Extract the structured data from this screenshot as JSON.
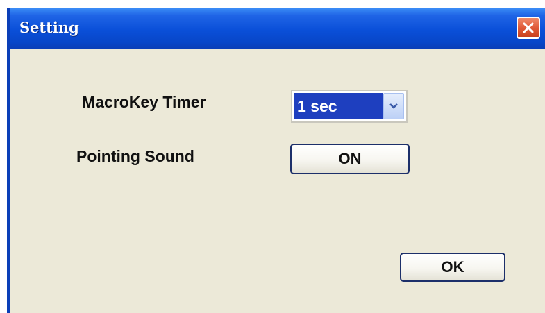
{
  "window": {
    "title": "Setting",
    "close_icon": "close-icon"
  },
  "settings": {
    "macrokey_label": "MacroKey Timer",
    "macrokey_value": "1 sec",
    "sound_label": "Pointing Sound",
    "sound_button": "ON"
  },
  "footer": {
    "ok_label": "OK"
  },
  "colors": {
    "titlebar": "#0a4fd8",
    "dialog_bg": "#ece9d8",
    "selection": "#1e3fbf",
    "close_button": "#e05a38"
  }
}
